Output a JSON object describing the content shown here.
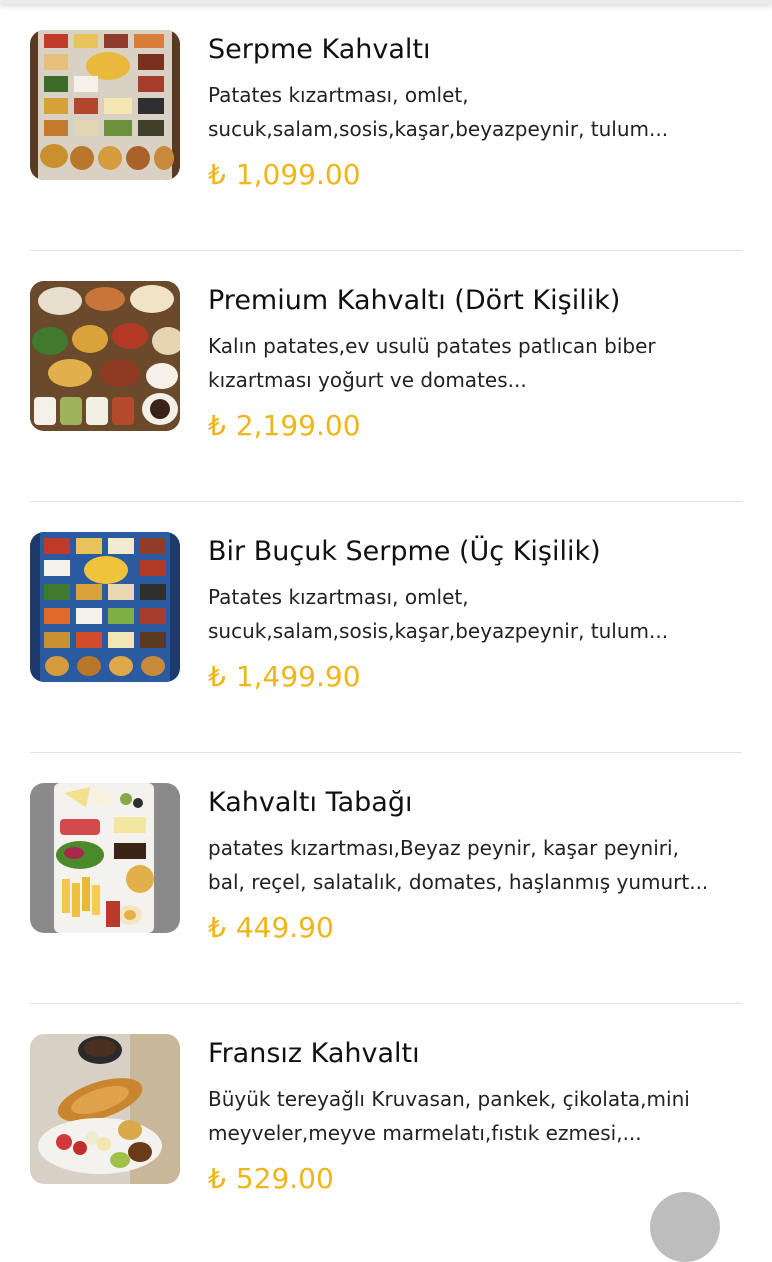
{
  "currency_symbol": "₺",
  "colors": {
    "price": "#f0b51b",
    "divider": "#e2e2e2",
    "text": "#111111"
  },
  "items": [
    {
      "name": "Serpme Kahvaltı",
      "desc_line1": "Patates kızartması, omlet,",
      "desc_line2": "sucuk,salam,sosis,kaşar,beyazpeynir, tulum...",
      "price": "1,099.00",
      "image": "serpme-breakfast-spread-photo"
    },
    {
      "name": "Premium Kahvaltı (Dört Kişilik)",
      "desc_line1": "Kalın patates,ev usulü patates patlıcan biber",
      "desc_line2": "kızartması yoğurt ve domates...",
      "price": "2,199.00",
      "image": "premium-breakfast-table-photo"
    },
    {
      "name": "Bir Buçuk Serpme (Üç Kişilik)",
      "desc_line1": "Patates kızartması, omlet,",
      "desc_line2": "sucuk,salam,sosis,kaşar,beyazpeynir, tulum...",
      "price": "1,499.90",
      "image": "bir-bucuk-serpme-photo"
    },
    {
      "name": "Kahvaltı Tabağı",
      "desc_line1": "patates kızartması,Beyaz peynir, kaşar peyniri,",
      "desc_line2": "bal, reçel, salatalık, domates, haşlanmış yumurt...",
      "price": "449.90",
      "image": "breakfast-plate-photo"
    },
    {
      "name": "Fransız Kahvaltı",
      "desc_line1": "Büyük tereyağlı Kruvasan, pankek, çikolata,mini",
      "desc_line2": "meyveler,meyve marmelatı,fıstık ezmesi,...",
      "price": "529.00",
      "image": "french-breakfast-photo"
    }
  ]
}
